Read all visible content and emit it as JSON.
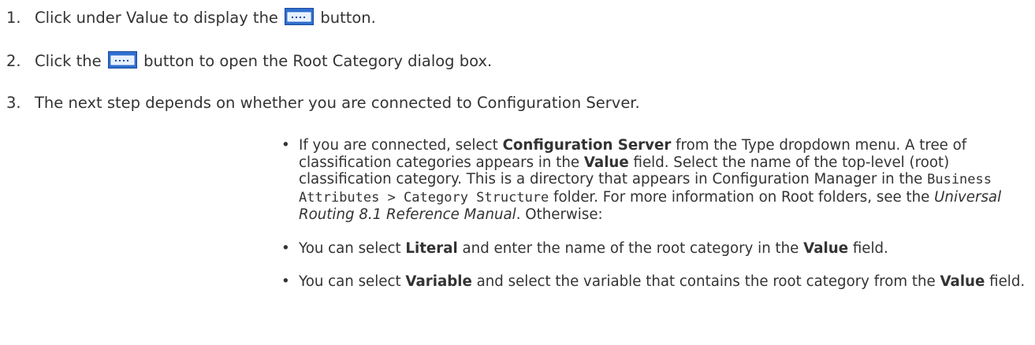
{
  "steps": [
    {
      "number": "1.",
      "text_before": "Click under Value to display the",
      "icon": "ellipsis-button-icon",
      "text_after": "button."
    },
    {
      "number": "2.",
      "text_before": "Click the",
      "icon": "ellipsis-button-icon",
      "text_after": "button to open the Root Category dialog box."
    },
    {
      "number": "3.",
      "text": "The next step depends on whether you are connected to Configuration Server."
    }
  ],
  "bullets": [
    {
      "bullet": "•",
      "t1": "If you are connected, select ",
      "b1": "Configuration Server",
      "t2": " from the Type dropdown menu. A tree of classification categories appears in the ",
      "b2": "Value",
      "t3": " field. Select the name of the top-level (root) classification category. This is a directory that appears in Configuration Manager in the ",
      "code": "Business Attributes > Category Structure",
      "t4": " folder. For more information on Root folders, see the ",
      "italic": "Universal Routing 8.1 Reference Manual",
      "t5": ". Otherwise:"
    },
    {
      "bullet": "•",
      "t1": "You can select ",
      "b1": "Literal",
      "t2": " and enter the name of the root category in the ",
      "b2": "Value",
      "t3": " field."
    },
    {
      "bullet": "•",
      "t1": "You can select ",
      "b1": "Variable",
      "t2": " and select the variable that contains the root category from the ",
      "b2": "Value",
      "t3": " field."
    }
  ],
  "colors": {
    "text": "#333333",
    "button_fill": "#2f6fcf",
    "button_border": "#1b4a9c"
  }
}
